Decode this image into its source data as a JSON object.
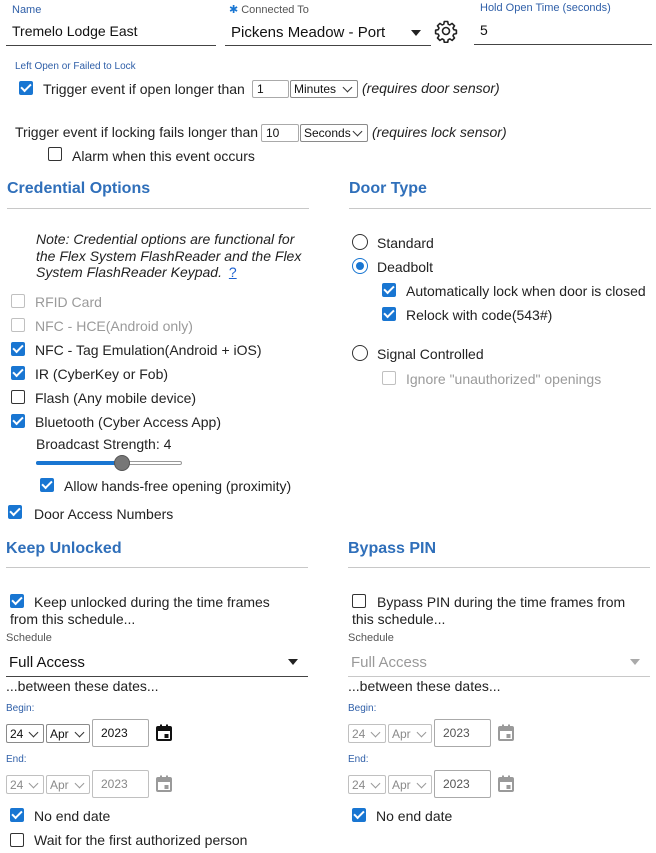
{
  "top": {
    "name_label": "Name",
    "name_value": "Tremelo Lodge East",
    "connected_label": "Connected To",
    "connected_value": "Pickens Meadow - Port",
    "hold_label": "Hold Open Time (seconds)",
    "hold_value": "5"
  },
  "left_open": {
    "section_label": "Left Open or Failed to Lock",
    "trigger_open_text": "Trigger event if open longer than",
    "trigger_open_value": "1",
    "trigger_open_unit": "Minutes",
    "trigger_open_note": "(requires door sensor)",
    "trigger_lock_text": "Trigger event if locking fails longer than",
    "trigger_lock_value": "10",
    "trigger_lock_unit": "Seconds",
    "trigger_lock_note": "(requires lock sensor)",
    "alarm_text": "Alarm when this event occurs"
  },
  "credentials": {
    "heading": "Credential Options",
    "note": "Note: Credential options are functional for the Flex System FlashReader and the Flex System FlashReader Keypad.",
    "help_link": "?",
    "items": [
      {
        "label": "RFID Card",
        "state": "disabled"
      },
      {
        "label": "NFC - HCE(Android only)",
        "state": "disabled"
      },
      {
        "label": "NFC - Tag Emulation(Android + iOS)",
        "state": "checked"
      },
      {
        "label": "IR (CyberKey or Fob)",
        "state": "checked"
      },
      {
        "label": "Flash (Any mobile device)",
        "state": "unchecked"
      },
      {
        "label": "Bluetooth (Cyber Access App)",
        "state": "checked"
      }
    ],
    "broadcast_label": "Broadcast Strength: 4",
    "broadcast_level": 0.6,
    "handsfree_label": "Allow hands-free opening (proximity)",
    "door_access_label": "Door Access Numbers"
  },
  "door_type": {
    "heading": "Door Type",
    "standard": "Standard",
    "deadbolt": "Deadbolt",
    "auto_lock": "Automatically lock when door is closed",
    "relock": "Relock with code(543#)",
    "signal": "Signal Controlled",
    "ignore": "Ignore \"unauthorized\" openings"
  },
  "keep_unlocked": {
    "heading": "Keep Unlocked",
    "check_text_1": "Keep unlocked during the time frames",
    "check_text_2": "from this schedule...",
    "schedule_label": "Schedule",
    "schedule_value": "Full Access",
    "between": "...between these dates...",
    "begin_label": "Begin:",
    "begin_day": "24",
    "begin_month": "Apr",
    "begin_year": "2023",
    "end_label": "End:",
    "end_day": "24",
    "end_month": "Apr",
    "end_year": "2023",
    "no_end": "No end date",
    "wait_first": "Wait for the first authorized person"
  },
  "bypass": {
    "heading": "Bypass PIN",
    "check_text_1": "Bypass PIN during the time frames from",
    "check_text_2": "this schedule...",
    "schedule_label": "Schedule",
    "schedule_value": "Full Access",
    "between": "...between these dates...",
    "begin_label": "Begin:",
    "begin_day": "24",
    "begin_month": "Apr",
    "begin_year": "2023",
    "end_label": "End:",
    "end_day": "24",
    "end_month": "Apr",
    "end_year": "2023",
    "no_end": "No end date"
  },
  "colors": {
    "accent": "#1976d2",
    "heading": "#2f6fba",
    "label": "#2f5fa8"
  }
}
